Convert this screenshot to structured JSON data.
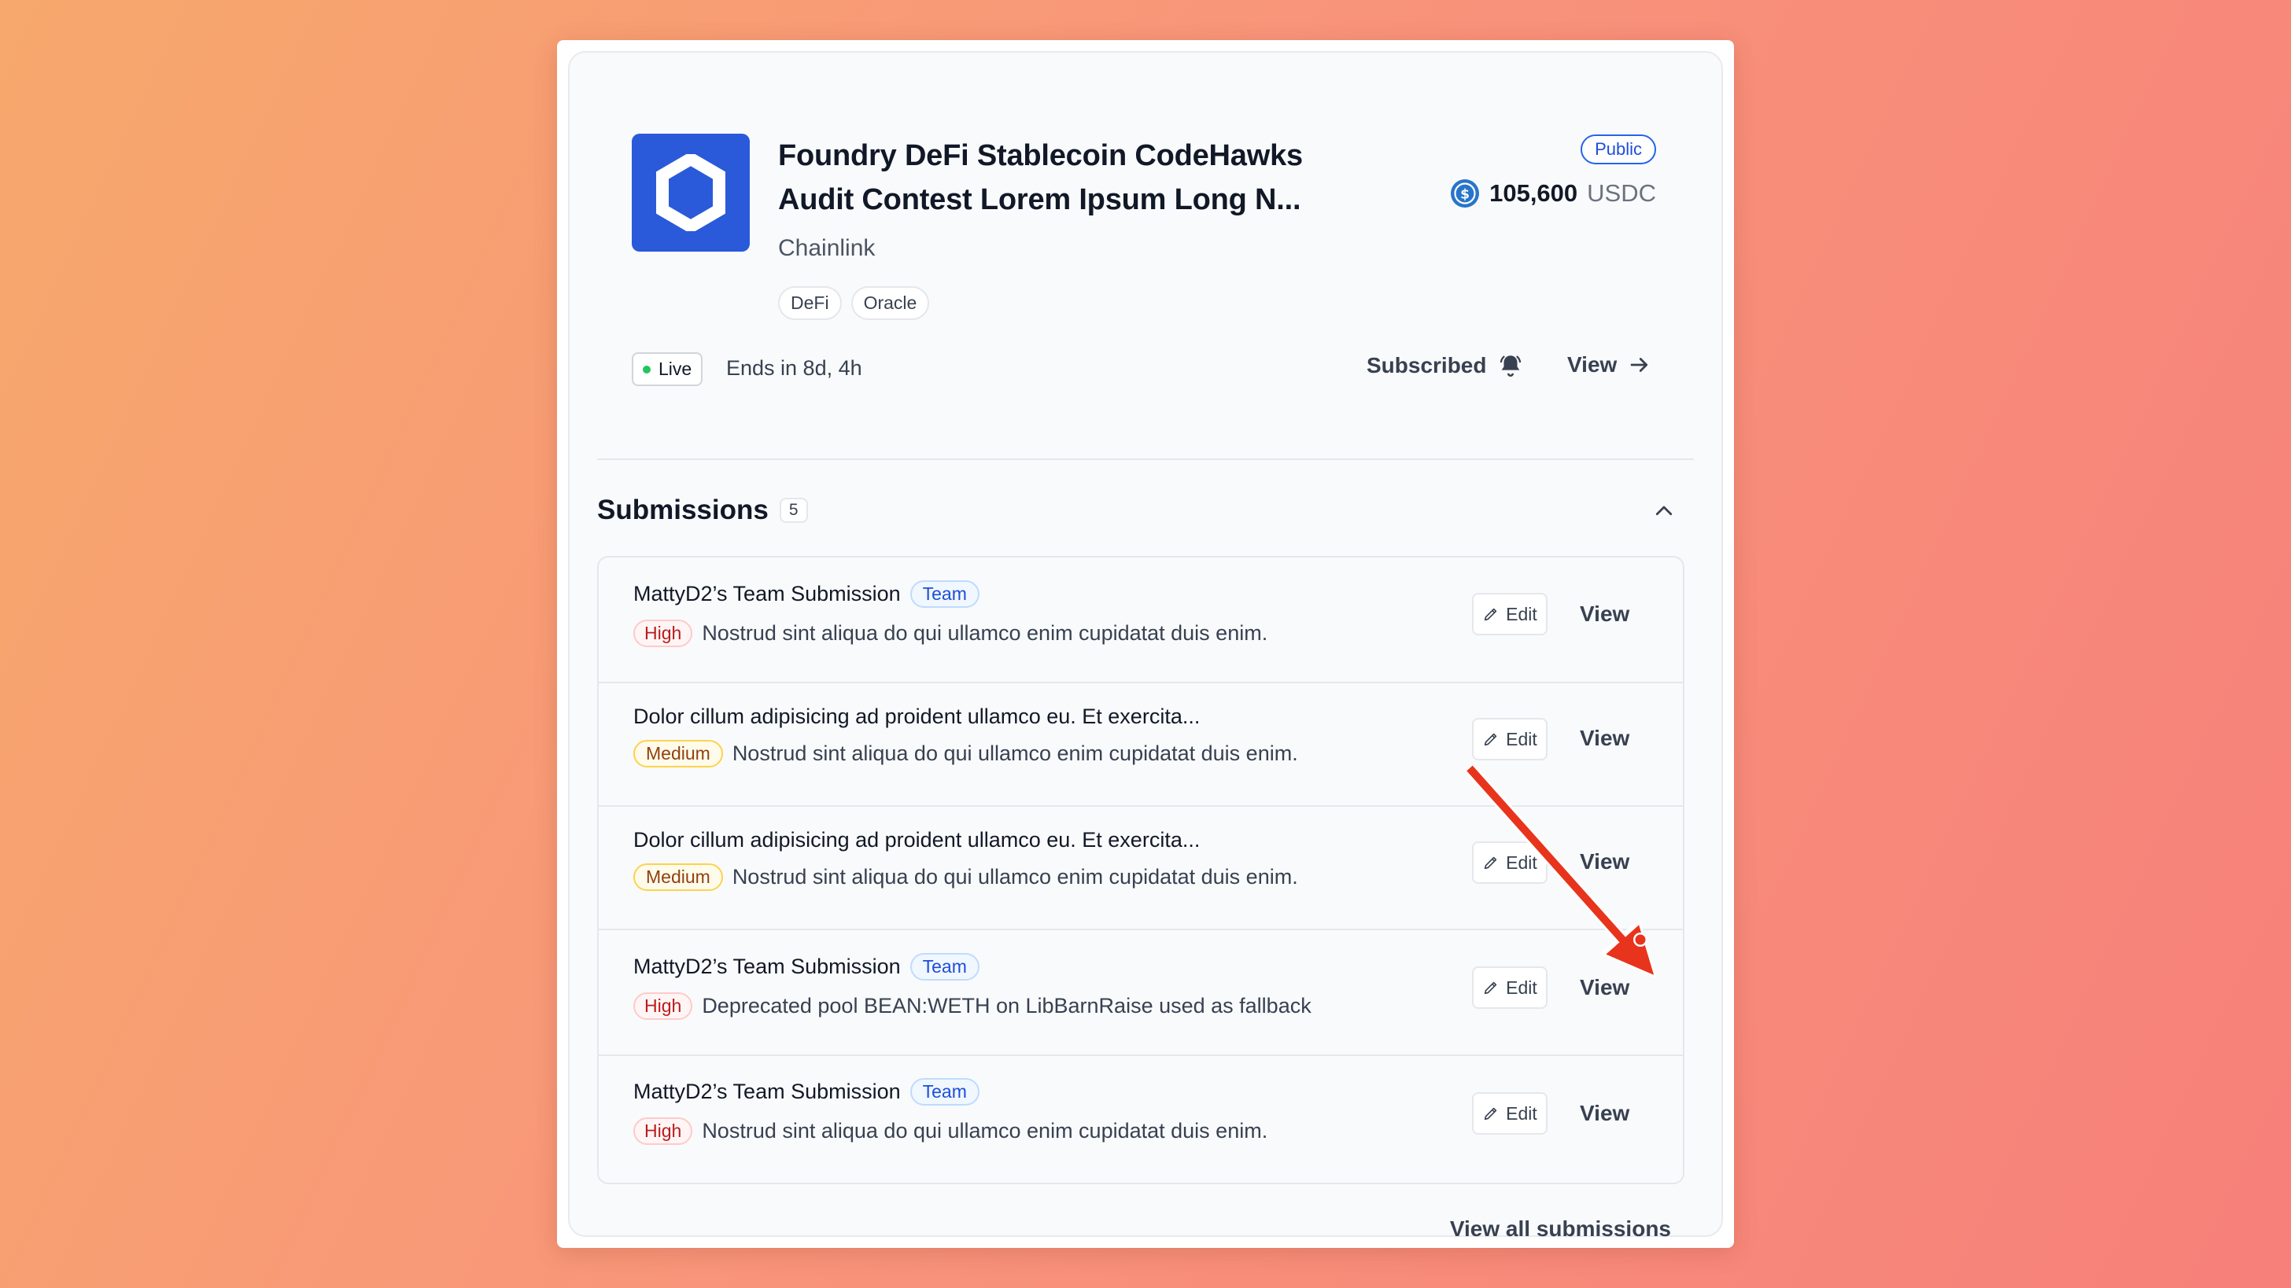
{
  "contest": {
    "title": "Foundry DeFi Stablecoin CodeHawks Audit Contest Lorem Ipsum Long N...",
    "organization": "Chainlink",
    "tags": [
      "DeFi",
      "Oracle"
    ],
    "visibility": "Public",
    "prize_amount": "105,600",
    "prize_currency": "USDC",
    "status": "Live",
    "ends": "Ends in 8d, 4h",
    "subscribed_label": "Subscribed",
    "view_label": "View"
  },
  "submissions": {
    "title": "Submissions",
    "count": "5",
    "items": [
      {
        "title": "MattyD2’s Team Submission",
        "team_badge": "Team",
        "severity": "High",
        "description": "Nostrud sint aliqua do qui ullamco enim cupidatat duis enim.",
        "edit_label": "Edit",
        "view_label": "View"
      },
      {
        "title": "Dolor cillum adipisicing ad proident ullamco eu. Et exercita...",
        "team_badge": "",
        "severity": "Medium",
        "description": "Nostrud sint aliqua do qui ullamco enim cupidatat duis enim.",
        "edit_label": "Edit",
        "view_label": "View"
      },
      {
        "title": "Dolor cillum adipisicing ad proident ullamco eu. Et exercita...",
        "team_badge": "",
        "severity": "Medium",
        "description": "Nostrud sint aliqua do qui ullamco enim cupidatat duis enim.",
        "edit_label": "Edit",
        "view_label": "View"
      },
      {
        "title": "MattyD2’s Team Submission",
        "team_badge": "Team",
        "severity": "High",
        "description": "Deprecated pool BEAN:WETH on LibBarnRaise used as fallback",
        "edit_label": "Edit",
        "view_label": "View"
      },
      {
        "title": "MattyD2’s Team Submission",
        "team_badge": "Team",
        "severity": "High",
        "description": "Nostrud sint aliqua do qui ullamco enim cupidatat duis enim.",
        "edit_label": "Edit",
        "view_label": "View"
      }
    ],
    "view_all_label": "View all submissions"
  },
  "colors": {
    "logo_bg": "#2a5ada",
    "annotation_arrow": "#e8341c",
    "live_dot": "#22c55e"
  }
}
